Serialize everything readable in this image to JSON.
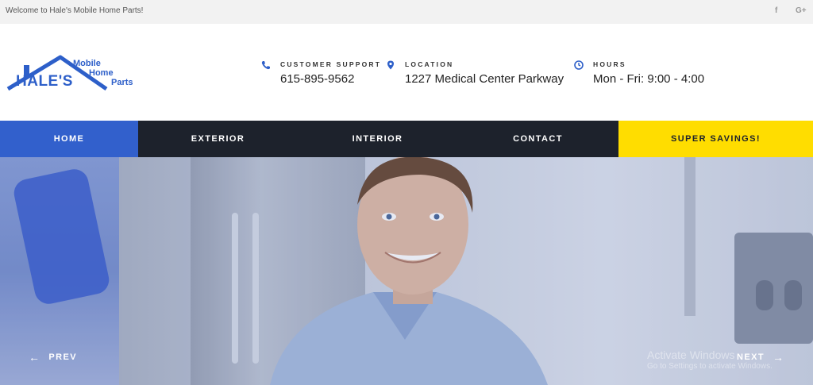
{
  "topbar": {
    "welcome": "Welcome to Hale's Mobile Home Parts!",
    "social": [
      {
        "icon": "facebook-icon",
        "label": "f"
      },
      {
        "icon": "google-plus-icon",
        "label": "G+"
      }
    ]
  },
  "logo": {
    "brand": "HALE'S",
    "line1": "Mobile",
    "line2": "Home",
    "line3": "Parts"
  },
  "header": {
    "support": {
      "icon": "phone-icon",
      "label": "CUSTOMER SUPPORT",
      "value": "615-895-9562"
    },
    "location": {
      "icon": "map-pin-icon",
      "label": "LOCATION",
      "value": "1227 Medical Center Parkway"
    },
    "hours": {
      "icon": "clock-icon",
      "label": "HOURS",
      "value": "Mon - Fri: 9:00 - 4:00"
    }
  },
  "nav": {
    "items": [
      {
        "label": "HOME",
        "active": true
      },
      {
        "label": "EXTERIOR"
      },
      {
        "label": "INTERIOR"
      },
      {
        "label": "CONTACT"
      },
      {
        "label": "SUPER SAVINGS!",
        "highlight": true
      }
    ]
  },
  "slider": {
    "prev_label": "PREV",
    "next_label": "NEXT"
  },
  "watermark": {
    "title": "Activate Windows",
    "subtitle": "Go to Settings to activate Windows."
  },
  "colors": {
    "accent_blue": "#3260cc",
    "nav_dark": "#1d222c",
    "savings_yellow": "#ffdd00",
    "topbar_bg": "#f2f2f2"
  }
}
